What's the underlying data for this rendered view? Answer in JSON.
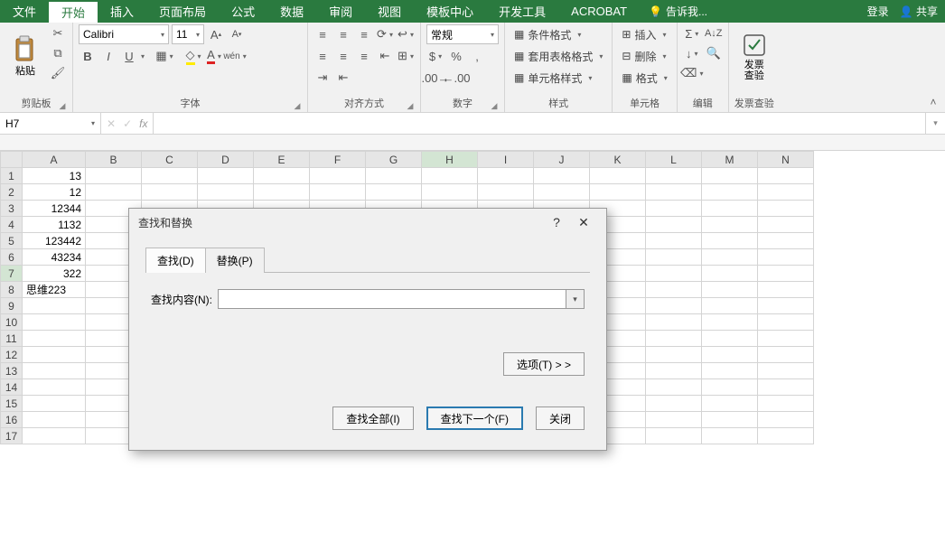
{
  "title_tabs": {
    "file": "文件",
    "home": "开始",
    "insert": "插入",
    "page_layout": "页面布局",
    "formulas": "公式",
    "data": "数据",
    "review": "审阅",
    "view": "视图",
    "template": "模板中心",
    "dev": "开发工具",
    "acrobat": "ACROBAT"
  },
  "tell_me": "告诉我...",
  "login": "登录",
  "share": "共享",
  "ribbon": {
    "clipboard": {
      "paste": "粘贴",
      "label": "剪贴板"
    },
    "font": {
      "name": "Calibri",
      "size": "11",
      "wen": "wén",
      "label": "字体"
    },
    "align": {
      "label": "对齐方式"
    },
    "number": {
      "format": "常规",
      "label": "数字"
    },
    "styles": {
      "cond": "条件格式",
      "table": "套用表格格式",
      "cell": "单元格样式",
      "label": "样式"
    },
    "cells": {
      "insert": "插入",
      "delete": "删除",
      "format": "格式",
      "label": "单元格"
    },
    "editing": {
      "label": "编辑"
    },
    "invoice": {
      "btn": "发票\n查验",
      "label": "发票查验"
    }
  },
  "name_box": "H7",
  "fx": "fx",
  "columns": [
    "A",
    "B",
    "C",
    "D",
    "E",
    "F",
    "G",
    "H",
    "I",
    "J",
    "K",
    "L",
    "M",
    "N"
  ],
  "active_col": "H",
  "active_row": 7,
  "col_widths": {
    "A": 70,
    "default": 62
  },
  "row_count": 17,
  "cells": {
    "A1": "13",
    "A2": "12",
    "A3": "12344",
    "A4": "1132",
    "A5": "123442",
    "A6": "43234",
    "A7": "322",
    "A8": "思维223"
  },
  "left_align_cells": [
    "A8"
  ],
  "dialog": {
    "title": "查找和替换",
    "tab_find": "查找(D)",
    "tab_replace": "替换(P)",
    "find_label": "查找内容(N):",
    "find_value": "",
    "options": "选项(T) > >",
    "find_all": "查找全部(I)",
    "find_next": "查找下一个(F)",
    "close": "关闭"
  }
}
